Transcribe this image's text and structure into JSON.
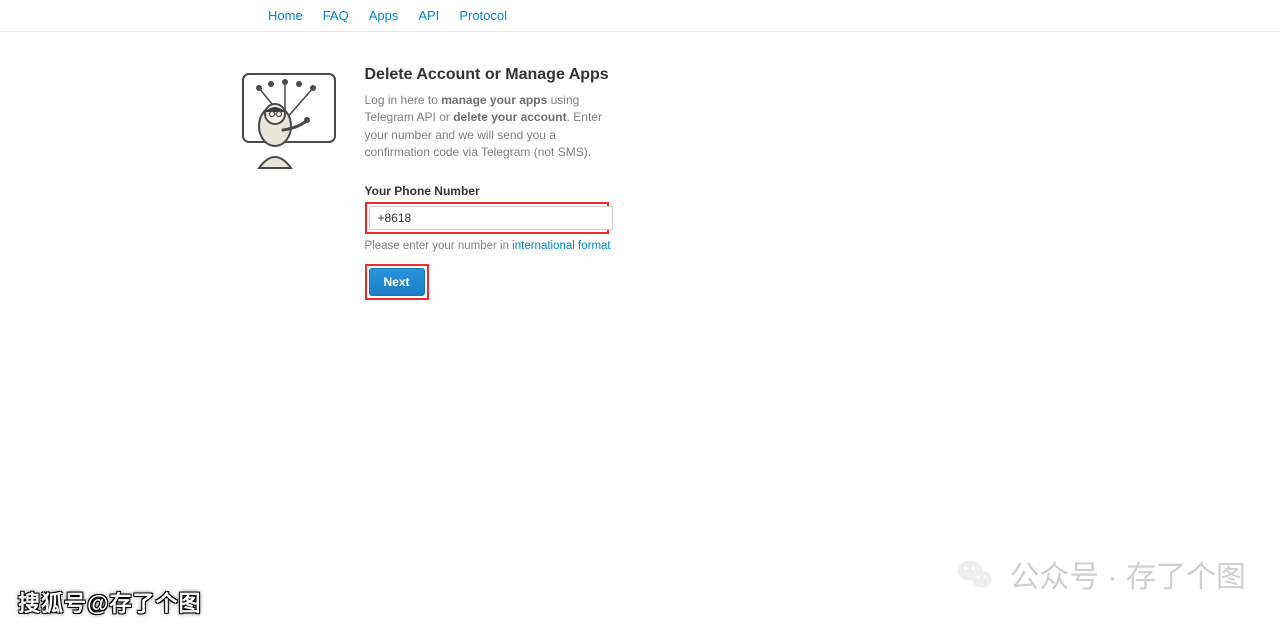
{
  "nav": {
    "items": [
      {
        "label": "Home"
      },
      {
        "label": "FAQ"
      },
      {
        "label": "Apps"
      },
      {
        "label": "API"
      },
      {
        "label": "Protocol"
      }
    ]
  },
  "page": {
    "title": "Delete Account or Manage Apps",
    "intro_prefix": "Log in here to ",
    "intro_strong1": "manage your apps",
    "intro_mid1": " using Telegram API or ",
    "intro_strong2": "delete your account",
    "intro_suffix": ". Enter your number and we will send you a confirmation code via Telegram (not SMS)."
  },
  "form": {
    "phone_label": "Your Phone Number",
    "phone_value": "+8618",
    "phone_placeholder": "+8618",
    "help_prefix": "Please enter your number in ",
    "help_link": "international format",
    "submit_label": "Next"
  },
  "watermarks": {
    "left": "搜狐号@存了个图",
    "right": "公众号 · 存了个图"
  }
}
